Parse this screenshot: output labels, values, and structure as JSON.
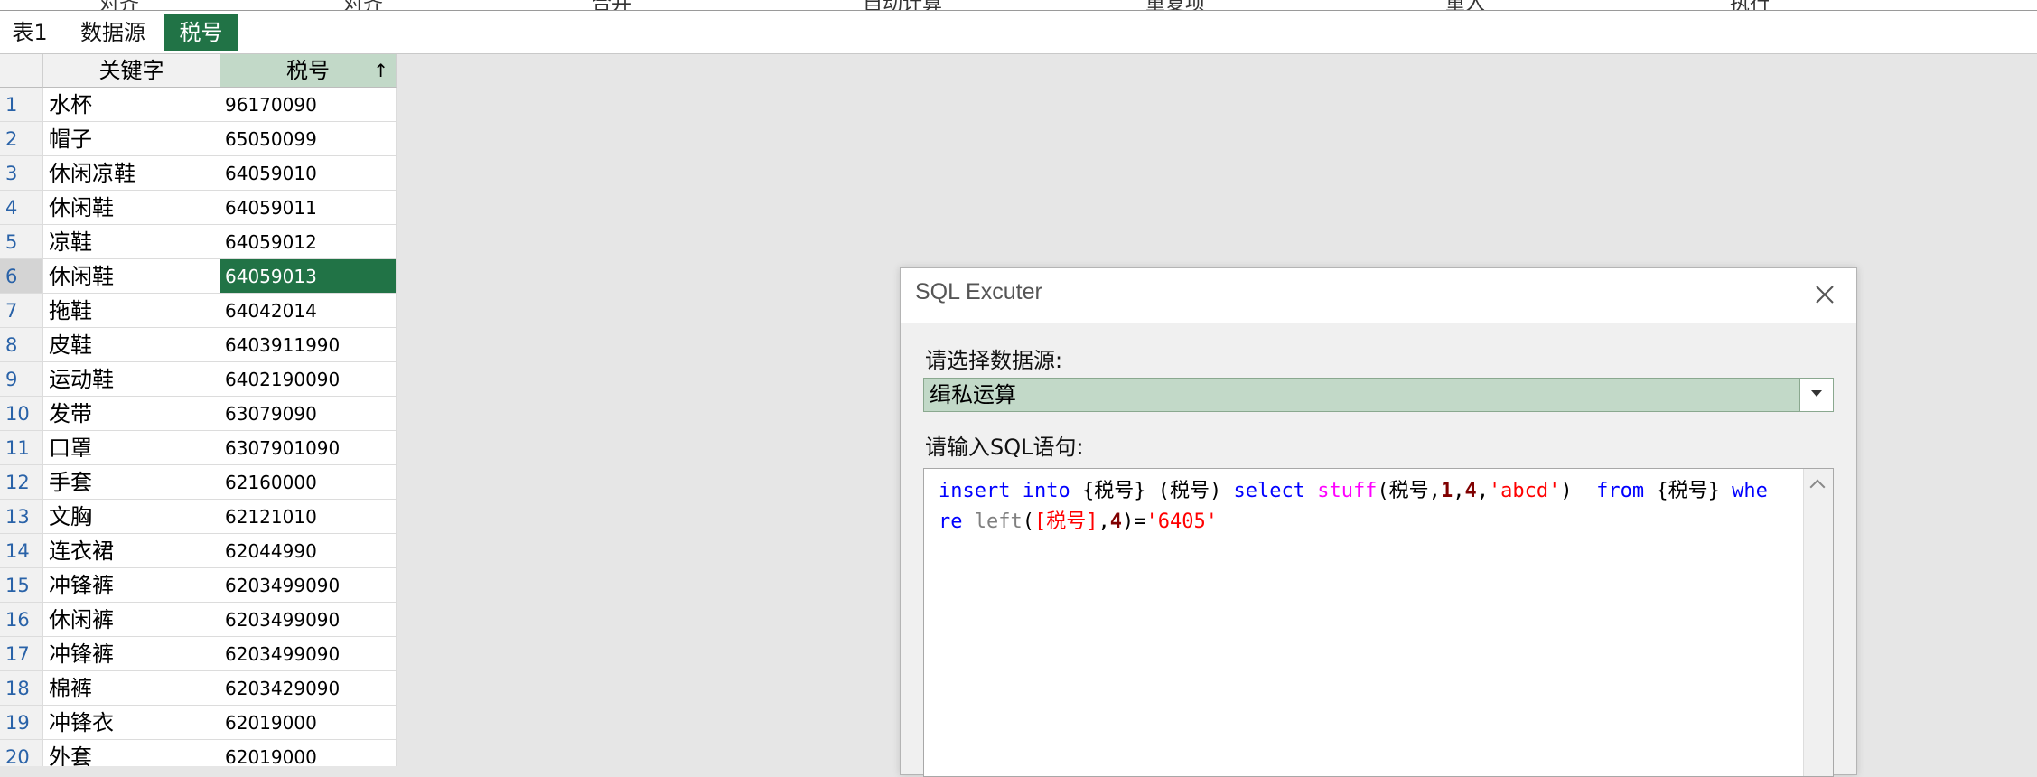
{
  "toolbar_items": [
    "对齐",
    "对齐",
    "合并",
    "自动计算",
    "重复项",
    "重入",
    "执行"
  ],
  "sheet_tabs": [
    {
      "label": "表1",
      "active": false
    },
    {
      "label": "数据源",
      "active": false
    },
    {
      "label": "税号",
      "active": true
    }
  ],
  "grid": {
    "columns": [
      "关键字",
      "税号"
    ],
    "sort_icon": "↑",
    "rows": [
      {
        "n": "1",
        "keyword": "水杯",
        "code": "96170090"
      },
      {
        "n": "2",
        "keyword": "帽子",
        "code": "65050099"
      },
      {
        "n": "3",
        "keyword": "休闲凉鞋",
        "code": "64059010"
      },
      {
        "n": "4",
        "keyword": "休闲鞋",
        "code": "64059011"
      },
      {
        "n": "5",
        "keyword": "凉鞋",
        "code": "64059012"
      },
      {
        "n": "6",
        "keyword": "休闲鞋",
        "code": "64059013"
      },
      {
        "n": "7",
        "keyword": "拖鞋",
        "code": "64042014"
      },
      {
        "n": "8",
        "keyword": "皮鞋",
        "code": "6403911990"
      },
      {
        "n": "9",
        "keyword": "运动鞋",
        "code": "6402190090"
      },
      {
        "n": "10",
        "keyword": "发带",
        "code": "63079090"
      },
      {
        "n": "11",
        "keyword": "口罩",
        "code": "6307901090"
      },
      {
        "n": "12",
        "keyword": "手套",
        "code": "62160000"
      },
      {
        "n": "13",
        "keyword": "文胸",
        "code": "62121010"
      },
      {
        "n": "14",
        "keyword": "连衣裙",
        "code": "62044990"
      },
      {
        "n": "15",
        "keyword": "冲锋裤",
        "code": "6203499090"
      },
      {
        "n": "16",
        "keyword": "休闲裤",
        "code": "6203499090"
      },
      {
        "n": "17",
        "keyword": "冲锋裤",
        "code": "6203499090"
      },
      {
        "n": "18",
        "keyword": "棉裤",
        "code": "6203429090"
      },
      {
        "n": "19",
        "keyword": "冲锋衣",
        "code": "62019000"
      },
      {
        "n": "20",
        "keyword": "外套",
        "code": "62019000"
      }
    ],
    "selected_row": "6"
  },
  "dialog": {
    "title": "SQL Excuter",
    "datasource_label": "请选择数据源:",
    "datasource_value": "缉私运算",
    "sql_label": "请输入SQL语句:",
    "sql": {
      "t1": "insert",
      "t2": "into",
      "t3": "{税号}",
      "t4": "(税号)",
      "t5": "select",
      "t6": "stuff",
      "t7": "(税号,",
      "t8": "1",
      "t9": ",",
      "t10": "4",
      "t11": ",",
      "t12": "'abcd'",
      "t13": ")",
      "t14": "from",
      "t15": "{税号}",
      "t16": "where",
      "t17": "left",
      "t18": "(",
      "t19": "[税号]",
      "t20": ",",
      "t21": "4",
      "t22": ")=",
      "t23": "'6405'"
    }
  },
  "colors": {
    "accent": "#217346",
    "selection_light": "#c2d9c8",
    "keyword": "#0000ff",
    "function": "#ff00ff",
    "string": "#ff0000"
  }
}
